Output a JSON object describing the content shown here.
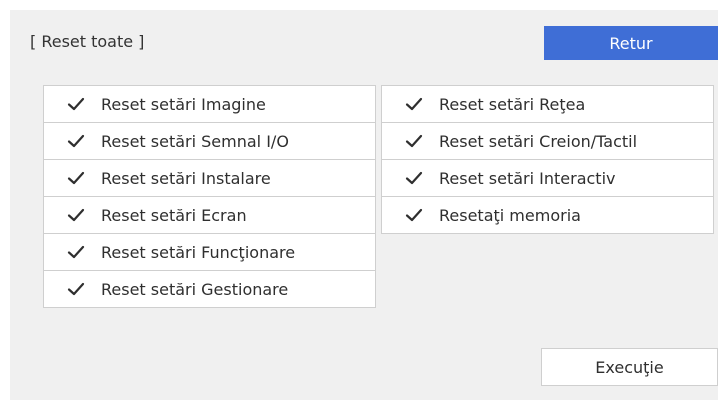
{
  "header": {
    "title": "[ Reset toate ]",
    "back_label": "Retur"
  },
  "left_items": [
    {
      "label": "Reset setări Imagine",
      "checked": true
    },
    {
      "label": "Reset setări Semnal I/O",
      "checked": true
    },
    {
      "label": "Reset setări Instalare",
      "checked": true
    },
    {
      "label": "Reset setări Ecran",
      "checked": true
    },
    {
      "label": "Reset setări Funcţionare",
      "checked": true
    },
    {
      "label": "Reset setări Gestionare",
      "checked": true
    }
  ],
  "right_items": [
    {
      "label": "Reset setări Reţea",
      "checked": true
    },
    {
      "label": "Reset setări Creion/Tactil",
      "checked": true
    },
    {
      "label": "Reset setări Interactiv",
      "checked": true
    },
    {
      "label": "Resetaţi memoria",
      "checked": true
    }
  ],
  "footer": {
    "execute_label": "Execuţie"
  },
  "colors": {
    "accent": "#3f6ed6",
    "panel_background": "#f0f0f0",
    "item_background": "#ffffff",
    "divider": "#cfcfcf"
  },
  "icons": {
    "item_check": "checkmark-icon"
  }
}
